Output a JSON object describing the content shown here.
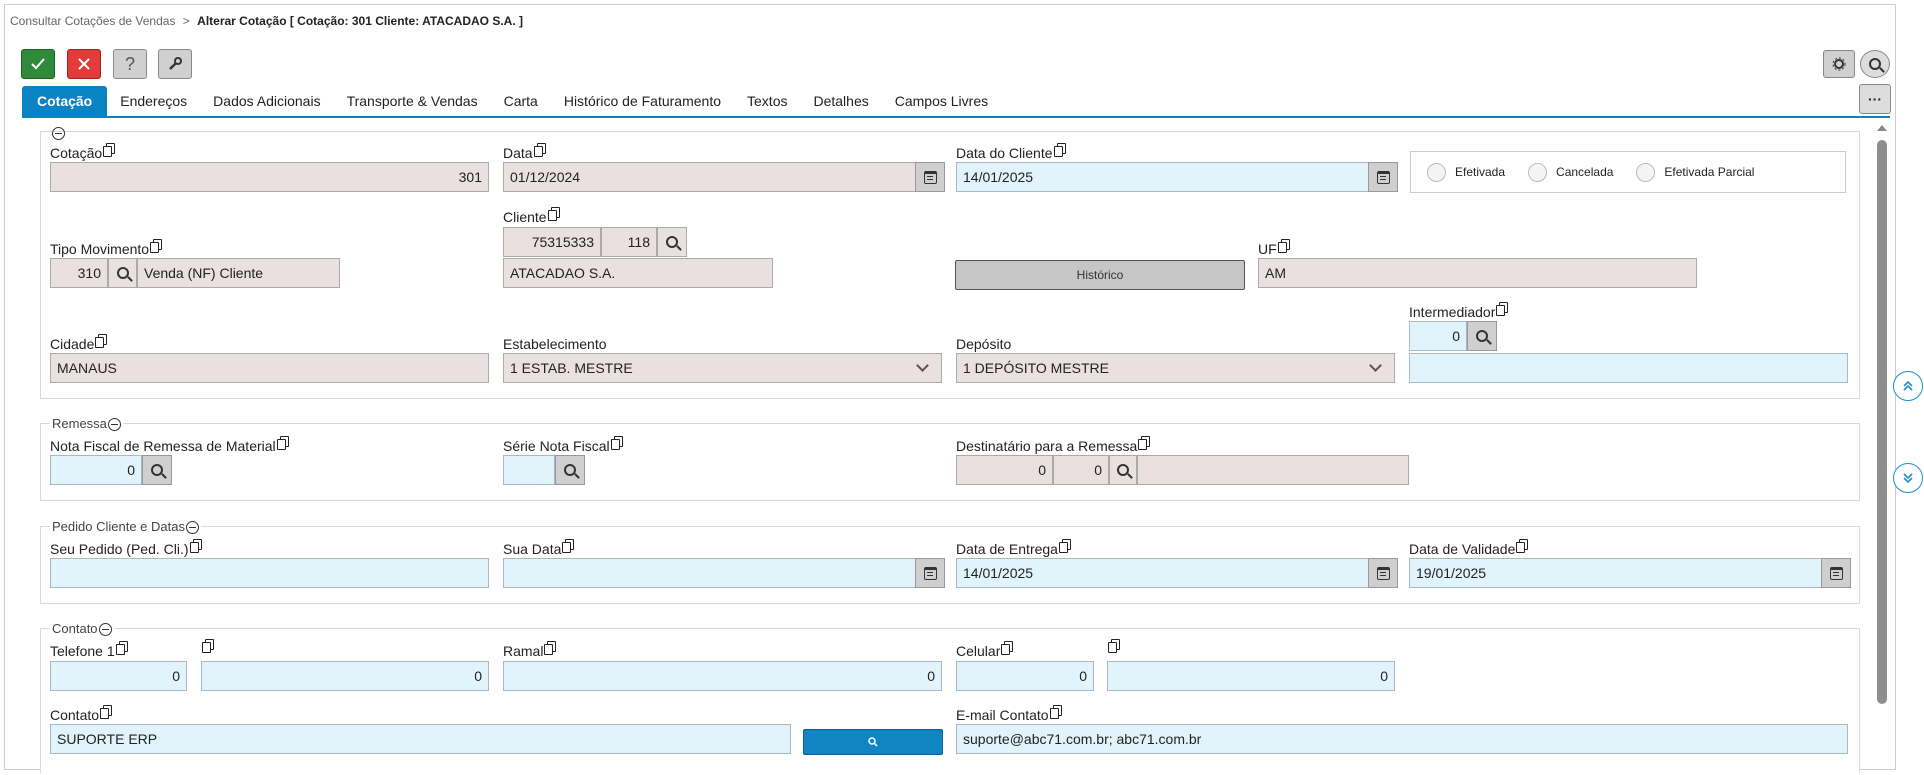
{
  "breadcrumb": {
    "parent": "Consultar Cotações de Vendas",
    "separator": ">",
    "current": "Alterar Cotação [ Cotação: 301 Cliente: ATACADAO S.A. ]"
  },
  "toolbar": {
    "confirm_icon": "check-icon",
    "cancel_icon": "close-icon",
    "help_label": "?",
    "tools_icon": "wrench-icon",
    "settings_icon": "gear-icon",
    "search_icon": "search-icon",
    "more_label": "···"
  },
  "tabs": [
    "Cotação",
    "Endereços",
    "Dados Adicionais",
    "Transporte & Vendas",
    "Carta",
    "Histórico de Faturamento",
    "Textos",
    "Detalhes",
    "Campos Livres"
  ],
  "main": {
    "cotacao_label": "Cotação",
    "cotacao_value": "301",
    "data_label": "Data",
    "data_value": "01/12/2024",
    "data_cliente_label": "Data do Cliente",
    "data_cliente_value": "14/01/2025",
    "status_options": [
      "Efetivada",
      "Cancelada",
      "Efetivada Parcial"
    ],
    "tipo_mov_label": "Tipo Movimento",
    "tipo_mov_code": "310",
    "tipo_mov_desc": "Venda (NF) Cliente",
    "cliente_label": "Cliente",
    "cliente_code": "75315333",
    "cliente_sub": "118",
    "cliente_name": "ATACADAO S.A.",
    "historico_label": "Histórico",
    "uf_label": "UF",
    "uf_value": "AM",
    "cidade_label": "Cidade",
    "cidade_value": "MANAUS",
    "estab_label": "Estabelecimento",
    "estab_value": "1 ESTAB. MESTRE",
    "deposito_label": "Depósito",
    "deposito_value": "1 DEPÓSITO MESTRE",
    "intermed_label": "Intermediador",
    "intermed_value": "0",
    "intermed_desc": ""
  },
  "remessa": {
    "title": "Remessa",
    "nf_label": "Nota Fiscal de Remessa de Material",
    "nf_value": "0",
    "serie_label": "Série Nota Fiscal",
    "serie_value": "",
    "dest_label": "Destinatário para a Remessa",
    "dest_code1": "0",
    "dest_code2": "0",
    "dest_name": ""
  },
  "pedido": {
    "title": "Pedido Cliente e Datas",
    "seu_pedido_label": "Seu Pedido (Ped. Cli.)",
    "seu_pedido_value": "",
    "sua_data_label": "Sua Data",
    "sua_data_value": "",
    "entrega_label": "Data de Entrega",
    "entrega_value": "14/01/2025",
    "validade_label": "Data de Validade",
    "validade_value": "19/01/2025"
  },
  "contato": {
    "title": "Contato",
    "tel1_label": "Telefone 1",
    "tel1_ddd": "0",
    "tel1_num": "0",
    "ramal_label": "Ramal",
    "ramal_value": "0",
    "celular_label": "Celular",
    "cel_ddd": "0",
    "cel_num": "0",
    "contato_label": "Contato",
    "contato_value": "SUPORTE ERP",
    "email_label": "E-mail Contato",
    "email_value": "suporte@abc71.com.br; abc71.com.br"
  },
  "colors": {
    "accent": "#0a83c4",
    "confirm": "#2f8a3a",
    "cancel": "#e23b3b",
    "readonly": "#ebe0e0",
    "editable": "#e1f4fb"
  }
}
